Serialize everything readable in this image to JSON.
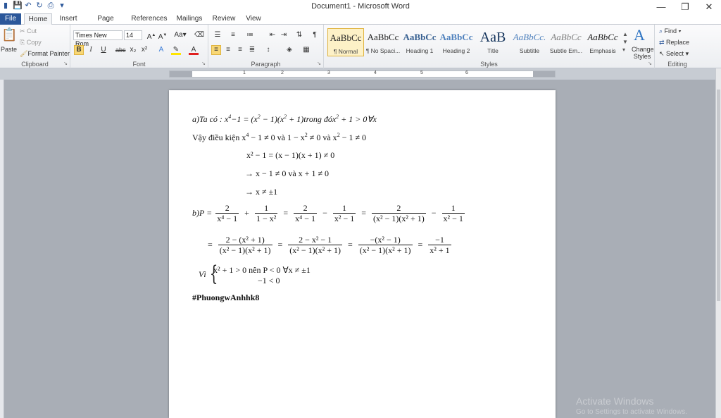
{
  "window": {
    "title": "Document1 - Microsoft Word",
    "controls": [
      "—",
      "❐",
      "✕"
    ]
  },
  "qat": [
    "save-icon",
    "undo-icon",
    "redo-icon",
    "print-preview-icon",
    "customize-icon"
  ],
  "tabs": [
    "File",
    "Home",
    "Insert",
    "Page Layout",
    "References",
    "Mailings",
    "Review",
    "View"
  ],
  "clipboard": {
    "paste": "Paste",
    "cut": "Cut",
    "copy": "Copy",
    "format_painter": "Format Painter",
    "label": "Clipboard"
  },
  "font": {
    "name": "Times New Rom",
    "size": "14",
    "label": "Font"
  },
  "paragraph": {
    "label": "Paragraph"
  },
  "styles": {
    "items": [
      {
        "sample": "AaBbCc",
        "name": "¶ Normal"
      },
      {
        "sample": "AaBbCc",
        "name": "¶ No Spaci..."
      },
      {
        "sample": "AaBbCc",
        "name": "Heading 1"
      },
      {
        "sample": "AaBbCc",
        "name": "Heading 2"
      },
      {
        "sample": "AaB",
        "name": "Title"
      },
      {
        "sample": "AaBbCc.",
        "name": "Subtitle"
      },
      {
        "sample": "AaBbCc",
        "name": "Subtle Em..."
      },
      {
        "sample": "AaBbCc",
        "name": "Emphasis"
      }
    ],
    "change": "Change Styles",
    "label": "Styles"
  },
  "editing": {
    "find": "Find",
    "replace": "Replace",
    "select": "Select",
    "label": "Editing"
  },
  "ruler": {
    "numbers": [
      "1",
      "2",
      "3",
      "4",
      "5",
      "6"
    ]
  },
  "document": {
    "line1_a": "a)Ta có : x",
    "line1_b": "4",
    "line1_c": "−1 = (x",
    "line1_d": "2",
    "line1_e": " − 1)(x",
    "line1_f": "2",
    "line1_g": " + 1)trong đóx",
    "line1_h": "2",
    "line1_i": " + 1 > 0∀x",
    "line2_a": "Vậy điều kiện x",
    "line2_b": "4",
    "line2_c": " − 1 ≠ 0 và 1 − x",
    "line2_d": "2",
    "line2_e": " ≠ 0 và x",
    "line2_f": "2",
    "line2_g": " − 1 ≠ 0",
    "line3": "x² − 1 = (x − 1)(x + 1) ≠ 0",
    "line4": "→ x − 1 ≠ 0 và x + 1 ≠ 0",
    "line5": "→ x ≠ ±1",
    "line6_prefix": "b)P = ",
    "line6_fracs": [
      {
        "n": "2",
        "d": "x⁴ − 1"
      },
      {
        "n": "1",
        "d": "1 − x²"
      },
      {
        "n": "2",
        "d": "x⁴ − 1"
      },
      {
        "n": "1",
        "d": "x² − 1"
      },
      {
        "n": "2",
        "d": "(x² − 1)(x² + 1)"
      },
      {
        "n": "1",
        "d": "x² − 1"
      }
    ],
    "line6_ops": [
      "+",
      "=",
      "−",
      "=",
      "−"
    ],
    "line7_fracs": [
      {
        "n": "2 − (x² + 1)",
        "d": "(x² − 1)(x² + 1)"
      },
      {
        "n": "2 − x² − 1",
        "d": "(x² − 1)(x² + 1)"
      },
      {
        "n": "−(x² − 1)",
        "d": "(x² − 1)(x² + 1)"
      },
      {
        "n": "−1",
        "d": "x² + 1"
      }
    ],
    "eq": "=",
    "vi": "Vì",
    "sys1": "x² + 1 > 0 nên P < 0 ∀x ≠ ±1",
    "sys2": "−1 < 0",
    "tag": "#PhuongwAnhhk8"
  },
  "watermark": {
    "line1": "Activate Windows",
    "line2": "Go to Settings to activate Windows."
  }
}
